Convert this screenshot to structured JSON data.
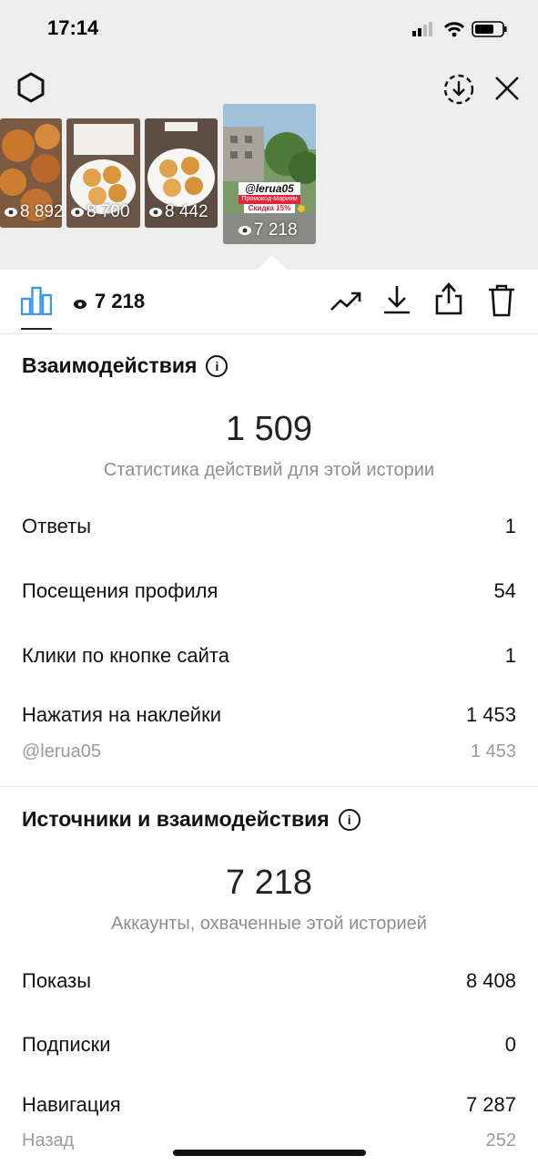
{
  "status_bar": {
    "time": "17:14"
  },
  "thumbnails": [
    {
      "views": "8 892"
    },
    {
      "views": "8 700"
    },
    {
      "views": "8 442"
    },
    {
      "views": "7 218",
      "sticker_handle": "@lerua05",
      "promo": "Промокод-Мариям",
      "discount": "Скидка 15%"
    }
  ],
  "toolbar": {
    "views": "7 218"
  },
  "interactions": {
    "title": "Взаимодействия",
    "total": "1 509",
    "subtitle": "Статистика действий для этой истории",
    "rows": [
      {
        "label": "Ответы",
        "value": "1"
      },
      {
        "label": "Посещения профиля",
        "value": "54"
      },
      {
        "label": "Клики по кнопке сайта",
        "value": "1"
      },
      {
        "label": "Нажатия на наклейки",
        "value": "1 453"
      }
    ],
    "sticker_row": {
      "label": "@lerua05",
      "value": "1 453"
    }
  },
  "discovery": {
    "title": "Источники и взаимодействия",
    "total": "7 218",
    "subtitle": "Аккаунты, охваченные этой историей",
    "rows": [
      {
        "label": "Показы",
        "value": "8 408"
      },
      {
        "label": "Подписки",
        "value": "0"
      },
      {
        "label": "Навигация",
        "value": "7 287"
      }
    ],
    "nav_sub": {
      "label": "Назад",
      "value": "252"
    }
  },
  "colors": {
    "accent": "#3897f0",
    "muted": "#8e8e8e"
  }
}
